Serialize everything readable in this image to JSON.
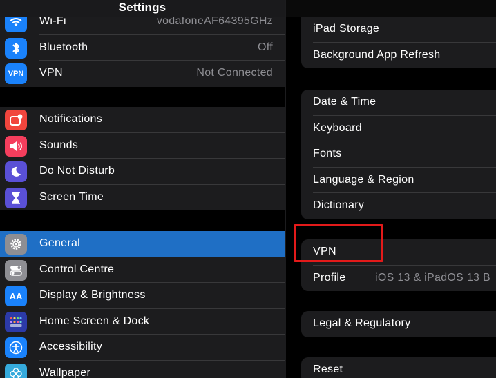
{
  "left_panel": {
    "title": "Settings",
    "group1": [
      {
        "label": "Wi-Fi",
        "value": "vodafoneAF64395GHz",
        "icon": "wifi-icon",
        "color": "#1a82fb"
      },
      {
        "label": "Bluetooth",
        "value": "Off",
        "icon": "bluetooth-icon",
        "color": "#1a82fb"
      },
      {
        "label": "VPN",
        "value": "Not Connected",
        "icon": "vpn-icon",
        "icon_text": "VPN",
        "color": "#1a82fb"
      }
    ],
    "group2": [
      {
        "label": "Notifications",
        "icon": "notifications-icon",
        "color": "#f1453d"
      },
      {
        "label": "Sounds",
        "icon": "sounds-icon",
        "color": "#f53e5d"
      },
      {
        "label": "Do Not Disturb",
        "icon": "moon-icon",
        "color": "#5a50d6"
      },
      {
        "label": "Screen Time",
        "icon": "hourglass-icon",
        "color": "#5a50d6"
      }
    ],
    "group3": [
      {
        "label": "General",
        "icon": "gear-icon",
        "color": "#8e8e93",
        "selected": true
      },
      {
        "label": "Control Centre",
        "icon": "toggles-icon",
        "color": "#8e8e93"
      },
      {
        "label": "Display & Brightness",
        "icon": "text-size-icon",
        "icon_text": "AA",
        "color": "#1a82fb"
      },
      {
        "label": "Home Screen & Dock",
        "icon": "grid-icon",
        "color": "#2c3aa8"
      },
      {
        "label": "Accessibility",
        "icon": "accessibility-icon",
        "color": "#1a82fb"
      },
      {
        "label": "Wallpaper",
        "icon": "flower-icon",
        "color": "#35aadc"
      }
    ]
  },
  "right_panel": {
    "group1": [
      {
        "label": "iPad Storage"
      },
      {
        "label": "Background App Refresh"
      }
    ],
    "group2": [
      {
        "label": "Date & Time"
      },
      {
        "label": "Keyboard"
      },
      {
        "label": "Fonts"
      },
      {
        "label": "Language & Region"
      },
      {
        "label": "Dictionary"
      }
    ],
    "group3": [
      {
        "label": "VPN"
      },
      {
        "label": "Profile",
        "value": "iOS 13 & iPadOS 13 B"
      }
    ],
    "group4": [
      {
        "label": "Legal & Regulatory"
      }
    ],
    "group5": [
      {
        "label": "Reset"
      }
    ]
  },
  "colors": {
    "selection": "#1f6fc5",
    "highlight_box": "#e31a1a"
  }
}
